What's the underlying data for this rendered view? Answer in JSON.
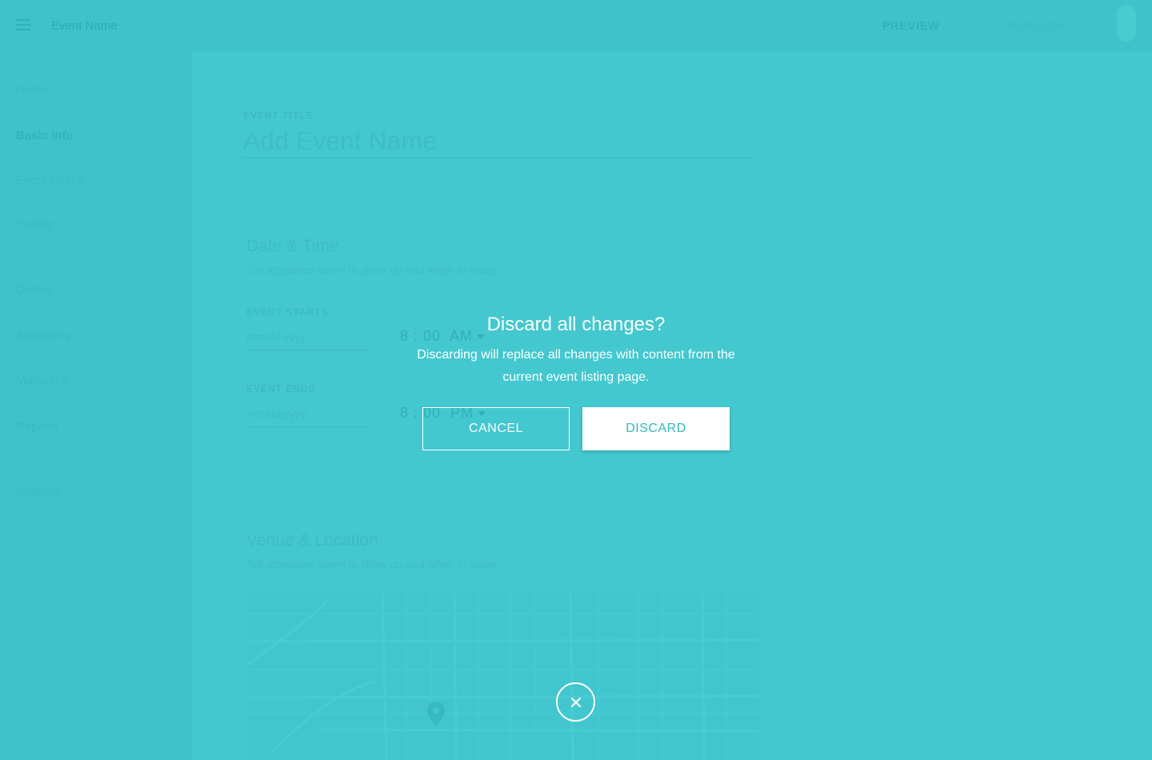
{
  "header": {
    "event_name": "Event Name",
    "preview_label": "PREVIEW",
    "publish_label": "PUBLISH"
  },
  "sidebar": {
    "items": [
      {
        "label": "Home"
      },
      {
        "label": "Basic Info"
      },
      {
        "label": "Event Listing"
      },
      {
        "label": "Tickets"
      },
      {
        "label": "Orders"
      },
      {
        "label": "Attendees"
      },
      {
        "label": "Marketing"
      },
      {
        "label": "Reports"
      },
      {
        "label": "Settings"
      }
    ],
    "active_item": "Basic Info"
  },
  "form": {
    "event_title_label": "EVENT TITLE",
    "event_title_placeholder": "Add Event Name",
    "date_time": {
      "title": "Date & Time",
      "subtitle": "Tell attendees when to show up and when to leave.",
      "starts_label": "EVENT STARTS",
      "starts_date_placeholder": "mm/dd/yyyy",
      "starts_time": "8 : 00  AM",
      "ends_label": "EVENT ENDS",
      "ends_date_placeholder": "mm/dd/yyyy",
      "ends_time": "8 : 00  PM"
    },
    "venue": {
      "title": "Venue & Location",
      "subtitle": "Tell attendees when to show up and when to leave."
    }
  },
  "dialog": {
    "title": "Discard all changes?",
    "body": "Discarding will replace all changes with content from the current event listing page.",
    "cancel_label": "CANCEL",
    "discard_label": "DISCARD",
    "close_icon": "close-icon"
  },
  "colors": {
    "accent": "#45c8d0",
    "dialog_text": "#ffffff",
    "discard_text": "#33b9c1"
  }
}
